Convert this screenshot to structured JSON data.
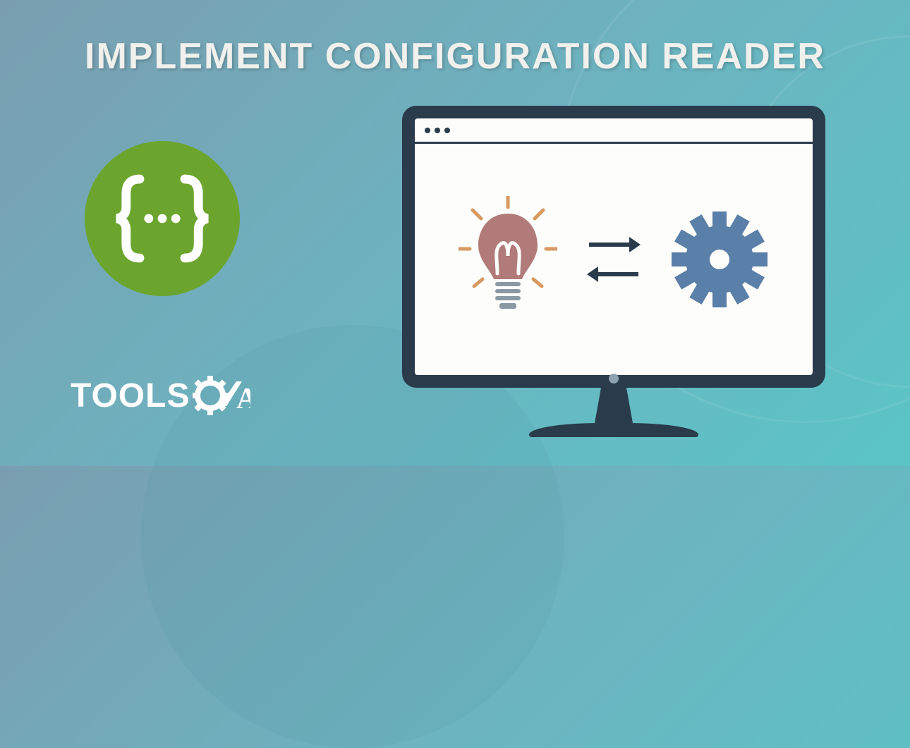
{
  "title": "IMPLEMENT CONFIGURATION READER",
  "logo": {
    "text": "TOOLS",
    "suffix": "A"
  },
  "badge": {
    "symbol": "{...}"
  },
  "colors": {
    "badge_bg": "#6ba52e",
    "monitor": "#2a3b4c",
    "bulb": "#b07b79",
    "rays": "#d8985f",
    "gear": "#5a7fa8"
  }
}
